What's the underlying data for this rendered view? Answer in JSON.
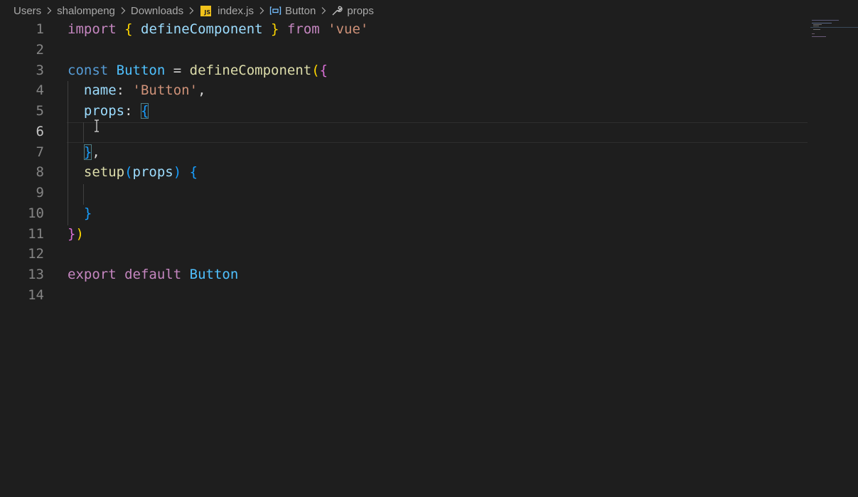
{
  "breadcrumb": {
    "items": [
      {
        "label": "Users",
        "icon": null
      },
      {
        "label": "shalompeng",
        "icon": null
      },
      {
        "label": "Downloads",
        "icon": null
      },
      {
        "label": "index.js",
        "icon": "js-file-icon",
        "badge": "JS"
      },
      {
        "label": "Button",
        "icon": "symbol-variable-icon"
      },
      {
        "label": "props",
        "icon": "wrench-property-icon"
      }
    ],
    "separator_icon": "chevron-right-icon"
  },
  "editor": {
    "active_line": 6,
    "cursor": {
      "line": 6,
      "column": 4
    },
    "lines": [
      {
        "number": "1",
        "tokens": [
          [
            "kw",
            "import"
          ],
          [
            "pl",
            " "
          ],
          [
            "b1",
            "{"
          ],
          [
            "pl",
            " "
          ],
          [
            "va",
            "defineComponent"
          ],
          [
            "pl",
            " "
          ],
          [
            "b1",
            "}"
          ],
          [
            "pl",
            " "
          ],
          [
            "kw",
            "from"
          ],
          [
            "pl",
            " "
          ],
          [
            "st",
            "'vue'"
          ]
        ]
      },
      {
        "number": "2",
        "tokens": []
      },
      {
        "number": "3",
        "tokens": [
          [
            "dc",
            "const"
          ],
          [
            "pl",
            " "
          ],
          [
            "cl",
            "Button"
          ],
          [
            "pl",
            " = "
          ],
          [
            "fn",
            "defineComponent"
          ],
          [
            "b1",
            "("
          ],
          [
            "b2",
            "{"
          ]
        ]
      },
      {
        "number": "4",
        "tokens": [
          [
            "pl",
            "  "
          ],
          [
            "va",
            "name"
          ],
          [
            "pl",
            ": "
          ],
          [
            "st",
            "'Button'"
          ],
          [
            "pl",
            ","
          ]
        ]
      },
      {
        "number": "5",
        "tokens": [
          [
            "pl",
            "  "
          ],
          [
            "va",
            "props"
          ],
          [
            "pl",
            ": "
          ],
          [
            "b3box",
            "{"
          ]
        ]
      },
      {
        "number": "6",
        "tokens": []
      },
      {
        "number": "7",
        "tokens": [
          [
            "pl",
            "  "
          ],
          [
            "b3box",
            "}"
          ],
          [
            "pl",
            ","
          ]
        ]
      },
      {
        "number": "8",
        "tokens": [
          [
            "pl",
            "  "
          ],
          [
            "fn",
            "setup"
          ],
          [
            "b3",
            "("
          ],
          [
            "va",
            "props"
          ],
          [
            "b3",
            ")"
          ],
          [
            "pl",
            " "
          ],
          [
            "b3",
            "{"
          ]
        ]
      },
      {
        "number": "9",
        "tokens": []
      },
      {
        "number": "10",
        "tokens": [
          [
            "pl",
            "  "
          ],
          [
            "b3",
            "}"
          ]
        ]
      },
      {
        "number": "11",
        "tokens": [
          [
            "b2",
            "}"
          ],
          [
            "b1",
            ")"
          ]
        ]
      },
      {
        "number": "12",
        "tokens": []
      },
      {
        "number": "13",
        "tokens": [
          [
            "kw",
            "export"
          ],
          [
            "pl",
            " "
          ],
          [
            "kw",
            "default"
          ],
          [
            "pl",
            " "
          ],
          [
            "cl",
            "Button"
          ]
        ]
      },
      {
        "number": "14",
        "tokens": []
      }
    ]
  },
  "colors": {
    "background": "#1e1e1e",
    "keyword": "#c586c0",
    "string": "#ce9178",
    "variable": "#9cdcfe",
    "class": "#4fc1ff",
    "function": "#dcdcaa",
    "declaration": "#569cd6",
    "bracket1": "#ffd700",
    "bracket2": "#da70d6",
    "bracket3": "#179fff",
    "js_badge": "#f1c21b"
  }
}
